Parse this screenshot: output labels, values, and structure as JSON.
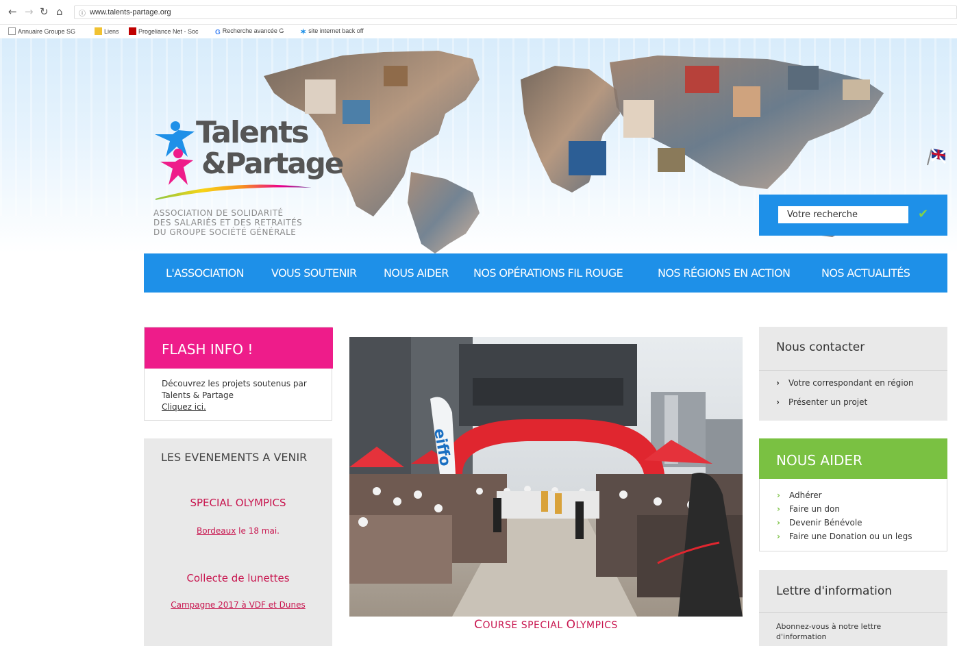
{
  "browser": {
    "url": "www.talents-partage.org",
    "bookmarks": [
      "Annuaire Groupe SG",
      "Liens",
      "Progeliance Net - Soc",
      "Recherche avancée G",
      "site internet back off"
    ]
  },
  "header": {
    "logo_line1": "Talents",
    "logo_line2": "&Partage",
    "tagline": [
      "ASSOCIATION DE SOLIDARITÉ",
      "DES SALARIÉS ET DES RETRAITÉS",
      "DU GROUPE SOCIÉTÉ GÉNÉRALE"
    ],
    "search_placeholder": "Votre recherche"
  },
  "nav": {
    "items": [
      "L'ASSOCIATION",
      "VOUS SOUTENIR",
      "NOUS AIDER",
      "NOS OPÉRATIONS FIL ROUGE",
      "NOS RÉGIONS EN ACTION",
      "NOS ACTUALITÉS"
    ]
  },
  "flash": {
    "title": "FLASH INFO !",
    "line1": "Découvrez les projets soutenus par",
    "line2": "Talents & Partage",
    "link": "Cliquez ici."
  },
  "events": {
    "title": "LES EVENEMENTS A VENIR",
    "items": [
      {
        "title": "SPECIAL OLYMPICS",
        "link": "Bordeaux",
        "date": " le  18 mai."
      },
      {
        "title": "Collecte de lunettes",
        "link": "Campagne 2017 à VDF et Dunes"
      }
    ]
  },
  "hero": {
    "caption_big1": "C",
    "caption_small1": "OURSE SPECIAL ",
    "caption_big2": "O",
    "caption_small2": "LYMPICS"
  },
  "contact": {
    "title": "Nous contacter",
    "links": [
      "Votre correspondant en région",
      "Présenter un projet"
    ]
  },
  "aider": {
    "title": "NOUS AIDER",
    "links": [
      "Adhérer",
      "Faire un don",
      "Devenir Bénévole",
      "Faire une Donation ou un legs"
    ]
  },
  "newsletter": {
    "title": "Lettre d'information",
    "text": "Abonnez-vous à notre lettre d'information"
  },
  "colors": {
    "nav_blue": "#1e90e8",
    "flash_pink": "#ee1c8a",
    "aider_green": "#7ac142",
    "event_red": "#c8164f"
  }
}
